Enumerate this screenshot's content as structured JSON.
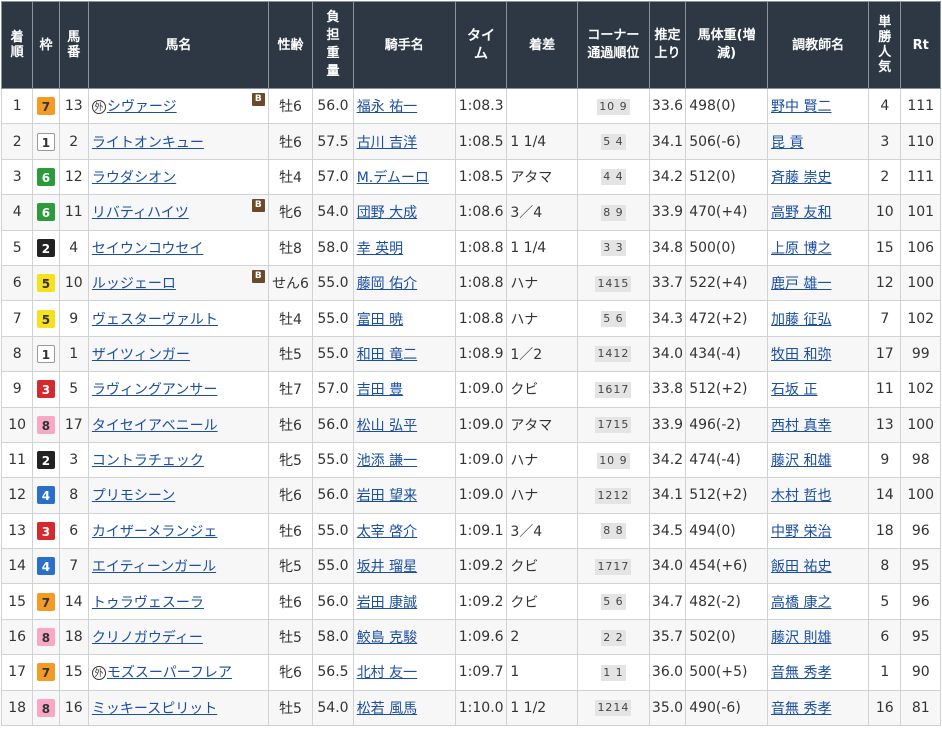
{
  "headers": {
    "rank": "着順",
    "frame": "枠",
    "number": "馬番",
    "horse": "馬名",
    "sexage": "性齢",
    "weight": "負担重量",
    "jockey": "騎手名",
    "time": "タイム",
    "margin": "着差",
    "corner": "コーナー通過順位",
    "last3f": "推定上り",
    "bodyweight": "馬体重(増減)",
    "trainer": "調教師名",
    "pop": "単勝人気",
    "rt": "Rt"
  },
  "frame_colors": {
    "1": {
      "bg": "#ffffff",
      "fg": "#333333",
      "border": "#999999"
    },
    "2": {
      "bg": "#222222",
      "fg": "#ffffff",
      "border": "#222222"
    },
    "3": {
      "bg": "#d6282f",
      "fg": "#ffffff",
      "border": "#d6282f"
    },
    "4": {
      "bg": "#2a6fc9",
      "fg": "#ffffff",
      "border": "#2a6fc9"
    },
    "5": {
      "bg": "#f5e11f",
      "fg": "#333333",
      "border": "#f5e11f"
    },
    "6": {
      "bg": "#2e9a3e",
      "fg": "#ffffff",
      "border": "#2e9a3e"
    },
    "7": {
      "bg": "#f39b25",
      "fg": "#333333",
      "border": "#f39b25"
    },
    "8": {
      "bg": "#f6a8c4",
      "fg": "#333333",
      "border": "#f6a8c4"
    }
  },
  "rows": [
    {
      "rank": "1",
      "frame": "7",
      "num": "13",
      "gai": "外",
      "horse": "シヴァージ",
      "blinker": "B",
      "sexage": "牡6",
      "weight": "56.0",
      "jockey": "福永 祐一",
      "time": "1:08.3",
      "margin": "",
      "corner": "10 9",
      "last3f": "33.6",
      "bw": "498(0)",
      "trainer": "野中 賢二",
      "pop": "4",
      "rt": "111"
    },
    {
      "rank": "2",
      "frame": "1",
      "num": "2",
      "gai": "",
      "horse": "ライトオンキュー",
      "blinker": "",
      "sexage": "牡6",
      "weight": "57.5",
      "jockey": "古川 吉洋",
      "time": "1:08.5",
      "margin": "1 1/4",
      "corner": "5 4",
      "last3f": "34.1",
      "bw": "506(-6)",
      "trainer": "昆 貢",
      "pop": "3",
      "rt": "110"
    },
    {
      "rank": "3",
      "frame": "6",
      "num": "12",
      "gai": "",
      "horse": "ラウダシオン",
      "blinker": "",
      "sexage": "牡4",
      "weight": "57.0",
      "jockey": "M.デムーロ",
      "time": "1:08.5",
      "margin": "アタマ",
      "corner": "4 4",
      "last3f": "34.2",
      "bw": "512(0)",
      "trainer": "斉藤 崇史",
      "pop": "2",
      "rt": "111"
    },
    {
      "rank": "4",
      "frame": "6",
      "num": "11",
      "gai": "",
      "horse": "リバティハイツ",
      "blinker": "B",
      "sexage": "牝6",
      "weight": "54.0",
      "jockey": "団野 大成",
      "time": "1:08.6",
      "margin": "3／4",
      "corner": "8 9",
      "last3f": "33.9",
      "bw": "470(+4)",
      "trainer": "高野 友和",
      "pop": "10",
      "rt": "101"
    },
    {
      "rank": "5",
      "frame": "2",
      "num": "4",
      "gai": "",
      "horse": "セイウンコウセイ",
      "blinker": "",
      "sexage": "牡8",
      "weight": "58.0",
      "jockey": "幸 英明",
      "time": "1:08.8",
      "margin": "1 1/4",
      "corner": "3 3",
      "last3f": "34.8",
      "bw": "500(0)",
      "trainer": "上原 博之",
      "pop": "15",
      "rt": "106"
    },
    {
      "rank": "6",
      "frame": "5",
      "num": "10",
      "gai": "",
      "horse": "ルッジェーロ",
      "blinker": "B",
      "sexage": "せん6",
      "weight": "55.0",
      "jockey": "藤岡 佑介",
      "time": "1:08.8",
      "margin": "ハナ",
      "corner": "1415",
      "last3f": "33.7",
      "bw": "522(+4)",
      "trainer": "鹿戸 雄一",
      "pop": "12",
      "rt": "100"
    },
    {
      "rank": "7",
      "frame": "5",
      "num": "9",
      "gai": "",
      "horse": "ヴェスターヴァルト",
      "blinker": "",
      "sexage": "牡4",
      "weight": "55.0",
      "jockey": "富田 暁",
      "time": "1:08.8",
      "margin": "ハナ",
      "corner": "5 6",
      "last3f": "34.3",
      "bw": "472(+2)",
      "trainer": "加藤 征弘",
      "pop": "7",
      "rt": "102"
    },
    {
      "rank": "8",
      "frame": "1",
      "num": "1",
      "gai": "",
      "horse": "ザイツィンガー",
      "blinker": "",
      "sexage": "牡5",
      "weight": "55.0",
      "jockey": "和田 竜二",
      "time": "1:08.9",
      "margin": "1／2",
      "corner": "1412",
      "last3f": "34.0",
      "bw": "434(-4)",
      "trainer": "牧田 和弥",
      "pop": "17",
      "rt": "99"
    },
    {
      "rank": "9",
      "frame": "3",
      "num": "5",
      "gai": "",
      "horse": "ラヴィングアンサー",
      "blinker": "",
      "sexage": "牡7",
      "weight": "57.0",
      "jockey": "吉田 豊",
      "time": "1:09.0",
      "margin": "クビ",
      "corner": "1617",
      "last3f": "33.8",
      "bw": "512(+2)",
      "trainer": "石坂 正",
      "pop": "11",
      "rt": "102"
    },
    {
      "rank": "10",
      "frame": "8",
      "num": "17",
      "gai": "",
      "horse": "タイセイアベニール",
      "blinker": "",
      "sexage": "牡6",
      "weight": "56.0",
      "jockey": "松山 弘平",
      "time": "1:09.0",
      "margin": "アタマ",
      "corner": "1715",
      "last3f": "33.9",
      "bw": "496(-2)",
      "trainer": "西村 真幸",
      "pop": "13",
      "rt": "100"
    },
    {
      "rank": "11",
      "frame": "2",
      "num": "3",
      "gai": "",
      "horse": "コントラチェック",
      "blinker": "",
      "sexage": "牝5",
      "weight": "55.0",
      "jockey": "池添 謙一",
      "time": "1:09.0",
      "margin": "ハナ",
      "corner": "10 9",
      "last3f": "34.2",
      "bw": "474(-4)",
      "trainer": "藤沢 和雄",
      "pop": "9",
      "rt": "98"
    },
    {
      "rank": "12",
      "frame": "4",
      "num": "8",
      "gai": "",
      "horse": "プリモシーン",
      "blinker": "",
      "sexage": "牝6",
      "weight": "56.0",
      "jockey": "岩田 望来",
      "time": "1:09.0",
      "margin": "ハナ",
      "corner": "1212",
      "last3f": "34.1",
      "bw": "512(+2)",
      "trainer": "木村 哲也",
      "pop": "14",
      "rt": "100"
    },
    {
      "rank": "13",
      "frame": "3",
      "num": "6",
      "gai": "",
      "horse": "カイザーメランジェ",
      "blinker": "",
      "sexage": "牡6",
      "weight": "55.0",
      "jockey": "太宰 啓介",
      "time": "1:09.1",
      "margin": "3／4",
      "corner": "8 8",
      "last3f": "34.5",
      "bw": "494(0)",
      "trainer": "中野 栄治",
      "pop": "18",
      "rt": "96"
    },
    {
      "rank": "14",
      "frame": "4",
      "num": "7",
      "gai": "",
      "horse": "エイティーンガール",
      "blinker": "",
      "sexage": "牝5",
      "weight": "55.0",
      "jockey": "坂井 瑠星",
      "time": "1:09.2",
      "margin": "クビ",
      "corner": "1717",
      "last3f": "34.0",
      "bw": "454(+6)",
      "trainer": "飯田 祐史",
      "pop": "8",
      "rt": "95"
    },
    {
      "rank": "15",
      "frame": "7",
      "num": "14",
      "gai": "",
      "horse": "トゥラヴェスーラ",
      "blinker": "",
      "sexage": "牡6",
      "weight": "56.0",
      "jockey": "岩田 康誠",
      "time": "1:09.2",
      "margin": "クビ",
      "corner": "5 6",
      "last3f": "34.7",
      "bw": "482(-2)",
      "trainer": "高橋 康之",
      "pop": "5",
      "rt": "96"
    },
    {
      "rank": "16",
      "frame": "8",
      "num": "18",
      "gai": "",
      "horse": "クリノガウディー",
      "blinker": "",
      "sexage": "牡5",
      "weight": "58.0",
      "jockey": "鮫島 克駿",
      "time": "1:09.6",
      "margin": "2",
      "corner": "2 2",
      "last3f": "35.7",
      "bw": "502(0)",
      "trainer": "藤沢 則雄",
      "pop": "6",
      "rt": "95"
    },
    {
      "rank": "17",
      "frame": "7",
      "num": "15",
      "gai": "外",
      "horse": "モズスーパーフレア",
      "blinker": "",
      "sexage": "牝6",
      "weight": "56.5",
      "jockey": "北村 友一",
      "time": "1:09.7",
      "margin": "1",
      "corner": "1 1",
      "last3f": "36.0",
      "bw": "500(+5)",
      "trainer": "音無 秀孝",
      "pop": "1",
      "rt": "90"
    },
    {
      "rank": "18",
      "frame": "8",
      "num": "16",
      "gai": "",
      "horse": "ミッキースピリット",
      "blinker": "",
      "sexage": "牡5",
      "weight": "54.0",
      "jockey": "松若 風馬",
      "time": "1:10.0",
      "margin": "1 1/2",
      "corner": "1214",
      "last3f": "35.0",
      "bw": "490(-6)",
      "trainer": "音無 秀孝",
      "pop": "16",
      "rt": "81"
    }
  ]
}
